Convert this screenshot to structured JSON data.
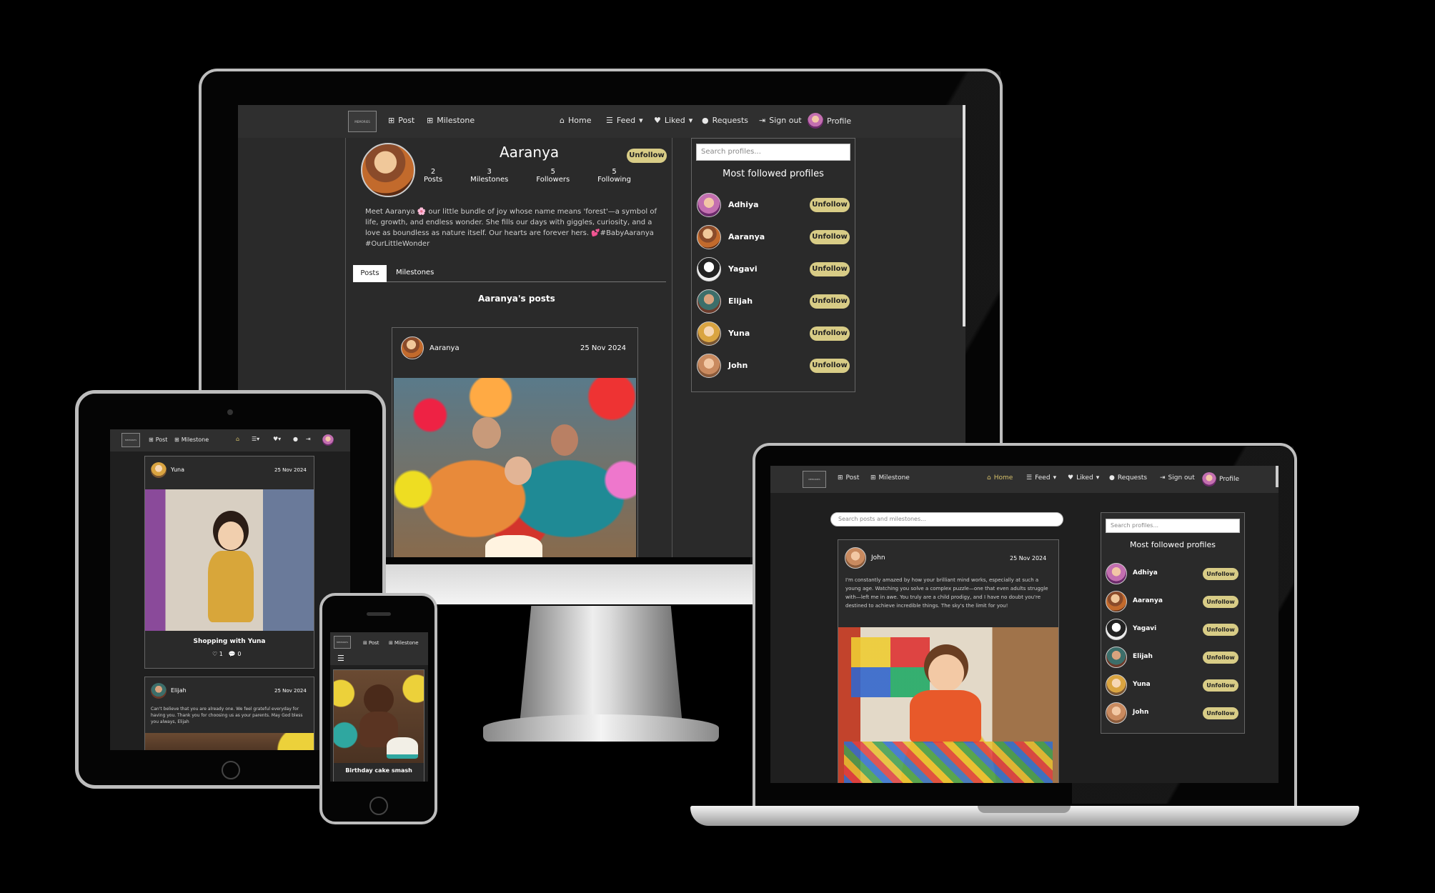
{
  "brand": {
    "logo_text": "MEMORIES"
  },
  "nav": {
    "post": "Post",
    "milestone": "Milestone",
    "home": "Home",
    "feed": "Feed",
    "liked": "Liked",
    "requests": "Requests",
    "signout": "Sign out",
    "profile": "Profile"
  },
  "monitor": {
    "profile": {
      "name": "Aaranya",
      "follow_button": "Unfollow",
      "stats": [
        {
          "value": "2",
          "label": "Posts"
        },
        {
          "value": "3",
          "label": "Milestones"
        },
        {
          "value": "5",
          "label": "Followers"
        },
        {
          "value": "5",
          "label": "Following"
        }
      ],
      "bio": "Meet Aaranya 🌸 our little bundle of joy whose name means 'forest'—a symbol of life, growth, and endless wonder. She fills our days with giggles, curiosity, and a love as boundless as nature itself. Our hearts are forever hers. 💕#BabyAaranya #OurLittleWonder",
      "tabs": [
        "Posts",
        "Milestones"
      ],
      "section_title": "Aaranya's posts"
    },
    "post": {
      "author": "Aaranya",
      "date": "25 Nov 2024"
    }
  },
  "sidebar": {
    "search_placeholder": "Search profiles...",
    "title": "Most followed profiles",
    "button": "Unfollow",
    "profiles": [
      "Adhiya",
      "Aaranya",
      "Yagavi",
      "Elijah",
      "Yuna",
      "John"
    ]
  },
  "laptop": {
    "search_placeholder": "Search posts and milestones...",
    "post": {
      "author": "John",
      "date": "25 Nov 2024",
      "text": "I'm constantly amazed by how your brilliant mind works, especially at such a young age. Watching you solve a complex puzzle—one that even adults struggle with—left me in awe. You truly are a child prodigy, and I have no doubt you're destined to achieve incredible things. The sky's the limit for you!"
    }
  },
  "tablet": {
    "post1": {
      "author": "Yuna",
      "date": "25 Nov 2024",
      "caption": "Shopping with Yuna",
      "likes": "1",
      "comments": "0"
    },
    "post2": {
      "author": "Elijah",
      "date": "25 Nov 2024",
      "text": "Can't believe that you are already one. We feel grateful everyday for having you. Thank you for choosing us as your parents. May God bless you always, Elijah"
    }
  },
  "phone": {
    "caption": "Birthday cake smash"
  }
}
